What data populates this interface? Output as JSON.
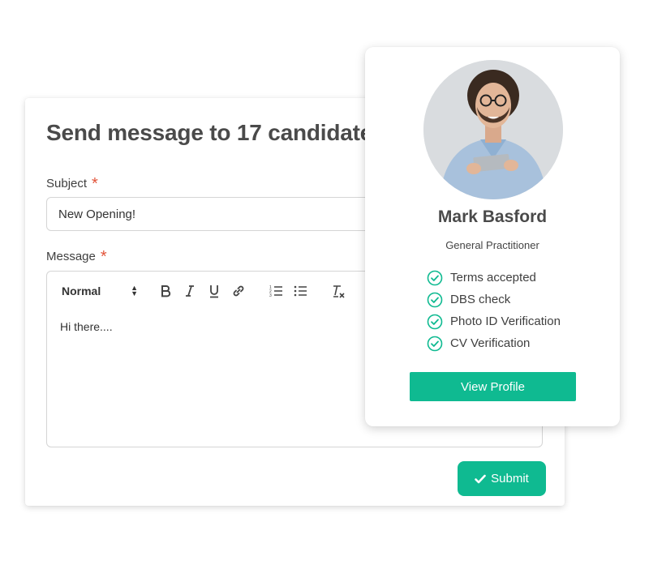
{
  "form": {
    "title": "Send message to 17 candidates",
    "subject_label": "Subject",
    "subject_required_mark": "*",
    "subject_value": "New Opening!",
    "message_label": "Message",
    "message_required_mark": "*",
    "editor": {
      "format_select": "Normal",
      "toolbar_icons": [
        "bold-icon",
        "italic-icon",
        "underline-icon",
        "link-icon",
        "ordered-list-icon",
        "bullet-list-icon",
        "clear-format-icon"
      ],
      "body_text": "Hi there...."
    },
    "submit_label": "Submit"
  },
  "profile": {
    "name": "Mark Basford",
    "role": "General Practitioner",
    "checklist": [
      "Terms accepted",
      "DBS check",
      "Photo ID Verification",
      "CV Verification"
    ],
    "view_label": "View Profile"
  },
  "colors": {
    "accent": "#0fba91",
    "required": "#e2543a",
    "text": "#3f3f3f"
  }
}
